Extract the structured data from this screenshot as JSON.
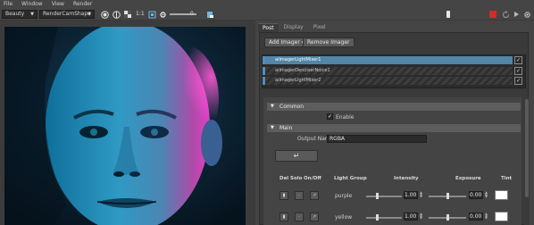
{
  "menu": [
    "File",
    "Window",
    "View",
    "Render"
  ],
  "toolbar": {
    "layer_dropdown": "Beauty",
    "camera_dropdown": "RenderCamShape",
    "ratio_label": "1:1",
    "exposure_value": "0"
  },
  "tabs": [
    {
      "label": "Post",
      "active": true
    },
    {
      "label": "Display",
      "active": false
    },
    {
      "label": "Pixel",
      "active": false
    }
  ],
  "buttons": {
    "add_imager": "Add Imager",
    "remove_imager": "Remove Imager"
  },
  "imagers": [
    {
      "name": "aiImagerLightMixer1",
      "selected": true,
      "checked": true
    },
    {
      "name": "aiImagerDenoiserNoice1",
      "selected": false,
      "checked": true
    },
    {
      "name": "aiImagerLightMixer2",
      "selected": false,
      "checked": true
    }
  ],
  "sections": {
    "common": "Common",
    "main": "Main"
  },
  "common": {
    "enable_label": "Enable",
    "enable_checked": true
  },
  "main": {
    "output_name_label": "Output Name",
    "output_name_value": "RGBA",
    "insert_icon": "↵"
  },
  "table": {
    "headers": [
      "Del",
      "Solo",
      "On/Off",
      "Light Group",
      "Intensity",
      "Exposure",
      "Tint"
    ],
    "rows": [
      {
        "group": "purple",
        "intensity": "1.00",
        "exposure": "0.00",
        "intensity_level": 0.32,
        "exposure_level": 0.5,
        "tint": "#ffffff"
      },
      {
        "group": "yellow",
        "intensity": "1.00",
        "exposure": "0.00",
        "intensity_level": 0.32,
        "exposure_level": 0.5,
        "tint": "#ffffff"
      }
    ]
  },
  "colors": {
    "selection": "#5285a6",
    "record_red": "#d52b2b",
    "panel_bg": "#444444"
  },
  "icons": [
    "settings-icon",
    "play-icon",
    "stop-icon",
    "refresh-icon",
    "trash-icon",
    "check-icon",
    "arrow-icon"
  ]
}
